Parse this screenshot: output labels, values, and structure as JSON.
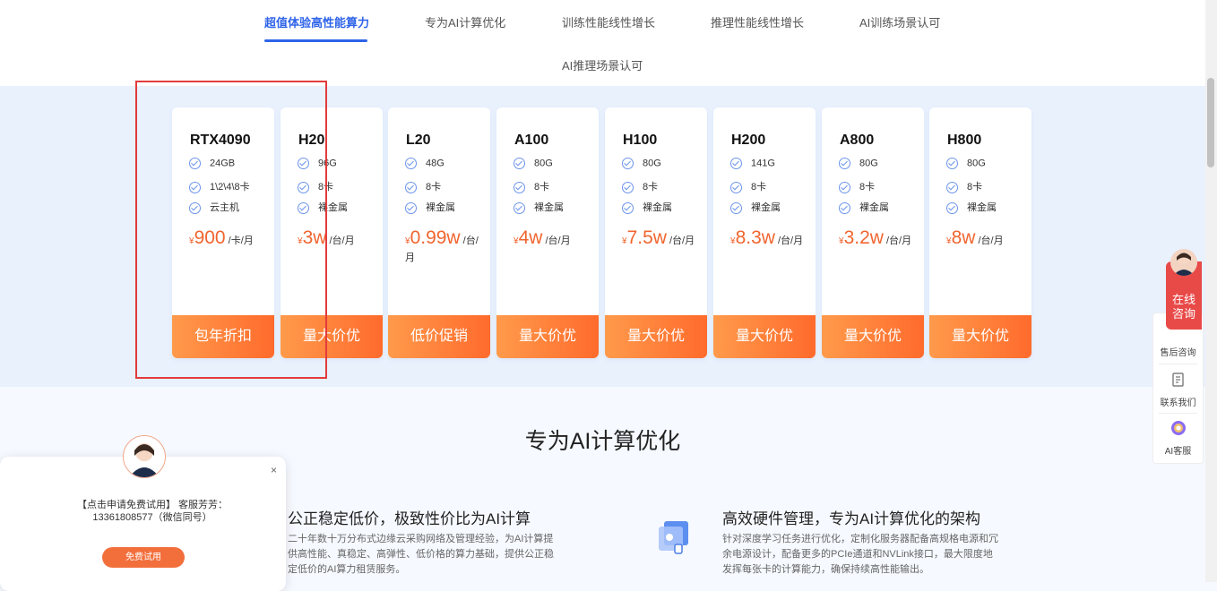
{
  "tabs": [
    "超值体验高性能算力",
    "专为AI计算优化",
    "训练性能线性增长",
    "推理性能线性增长",
    "AI训练场景认可",
    "AI推理场景认可"
  ],
  "products": [
    {
      "name": "RTX4090",
      "specs": [
        "24GB",
        "1\\2\\4\\8卡",
        "云主机"
      ],
      "currency": "¥",
      "price": "900",
      "unit": "/卡/月",
      "cta": "包年折扣"
    },
    {
      "name": "H20",
      "specs": [
        "96G",
        "8卡",
        "裸金属"
      ],
      "currency": "¥",
      "price": "3w",
      "unit": "/台/月",
      "cta": "量大价优"
    },
    {
      "name": "L20",
      "specs": [
        "48G",
        "8卡",
        "裸金属"
      ],
      "currency": "¥",
      "price": "0.99w",
      "unit": "/台/月",
      "cta": "低价促销"
    },
    {
      "name": "A100",
      "specs": [
        "80G",
        "8卡",
        "裸金属"
      ],
      "currency": "¥",
      "price": "4w",
      "unit": "/台/月",
      "cta": "量大价优"
    },
    {
      "name": "H100",
      "specs": [
        "80G",
        "8卡",
        "裸金属"
      ],
      "currency": "¥",
      "price": "7.5w",
      "unit": "/台/月",
      "cta": "量大价优"
    },
    {
      "name": "H200",
      "specs": [
        "141G",
        "8卡",
        "裸金属"
      ],
      "currency": "¥",
      "price": "8.3w",
      "unit": "/台/月",
      "cta": "量大价优"
    },
    {
      "name": "A800",
      "specs": [
        "80G",
        "8卡",
        "裸金属"
      ],
      "currency": "¥",
      "price": "3.2w",
      "unit": "/台/月",
      "cta": "量大价优"
    },
    {
      "name": "H800",
      "specs": [
        "80G",
        "8卡",
        "裸金属"
      ],
      "currency": "¥",
      "price": "8w",
      "unit": "/台/月",
      "cta": "量大价优"
    }
  ],
  "section": {
    "title": "专为AI计算优化",
    "features": [
      {
        "title": "公正稳定低价，极致性价比为AI计算",
        "desc": "二十年数十万分布式边缘云采购网络及管理经验，为AI计算提供高性能、真稳定、高弹性、低价格的算力基础，提供公正稳定低价的AI算力租赁服务。"
      },
      {
        "title": "高效硬件管理，专为AI计算优化的架构",
        "desc": "针对深度学习任务进行优化，定制化服务器配备高规格电源和冗余电源设计，配备更多的PCIe通道和NVLink接口，最大限度地发挥每张卡的计算能力，确保持续高性能输出。"
      }
    ]
  },
  "side": {
    "online_line1": "在线",
    "online_line2": "咨询",
    "items": [
      "售后咨询",
      "联系我们",
      "AI客服"
    ]
  },
  "popup": {
    "text": "【点击申请免费试用】 客服芳芳：13361808577（微信同号）",
    "button": "免费试用",
    "close": "×"
  },
  "colors": {
    "accent": "#2f64e9",
    "price": "#f0652f",
    "cta": "#ff6b2c"
  }
}
